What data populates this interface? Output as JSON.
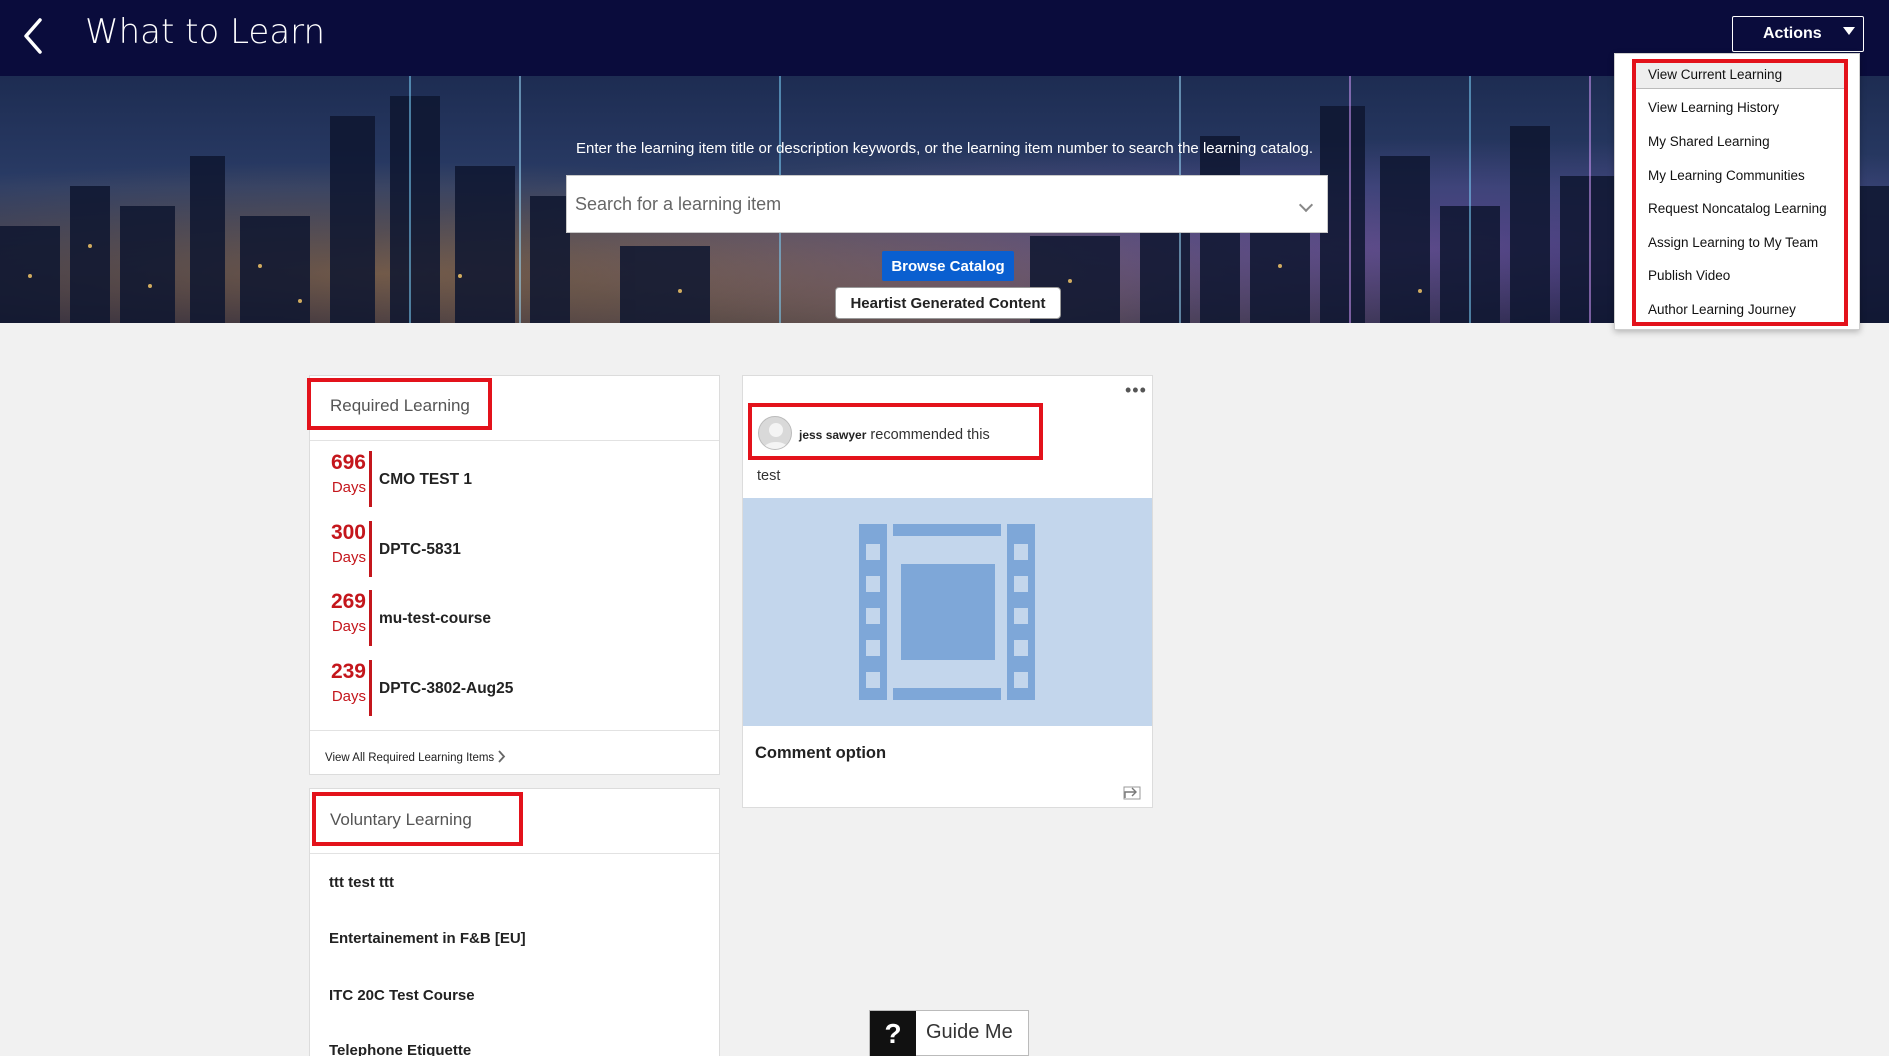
{
  "header": {
    "title": "What to Learn",
    "actions_label": "Actions"
  },
  "hero": {
    "hint": "Enter the learning item title or description keywords, or the learning item number to search the learning catalog.",
    "search_placeholder": "Search for a learning item",
    "browse_label": "Browse Catalog",
    "heartist_label": "Heartist Generated Content"
  },
  "actions_menu": {
    "items": [
      "View Current Learning",
      "View Learning History",
      "My Shared Learning",
      "My Learning Communities",
      "Request Noncatalog Learning",
      "Assign Learning to My Team",
      "Publish Video",
      "Author Learning Journey"
    ],
    "selected_index": 0
  },
  "required": {
    "title": "Required Learning",
    "days_label": "Days",
    "items": [
      {
        "days": "696",
        "name": "CMO TEST 1"
      },
      {
        "days": "300",
        "name": "DPTC-5831"
      },
      {
        "days": "269",
        "name": "mu-test-course"
      },
      {
        "days": "239",
        "name": "DPTC-3802-Aug25"
      }
    ],
    "view_all": "View All Required Learning Items"
  },
  "voluntary": {
    "title": "Voluntary Learning",
    "items": [
      "ttt test ttt",
      "Entertainement in F&B [EU]",
      "ITC 20C Test Course",
      "Telephone Etiquette"
    ]
  },
  "recommendation": {
    "user": "jess sawyer",
    "action": "recommended this",
    "note": "test",
    "item_title": "Comment option"
  },
  "guide": {
    "symbol": "?",
    "label": "Guide Me"
  },
  "colors": {
    "header_bg": "#0a0c3c",
    "accent_red": "#c4161c",
    "highlight_red": "#e3121b",
    "browse_blue": "#0a5fd0",
    "media_bg": "#c3d6ec"
  }
}
